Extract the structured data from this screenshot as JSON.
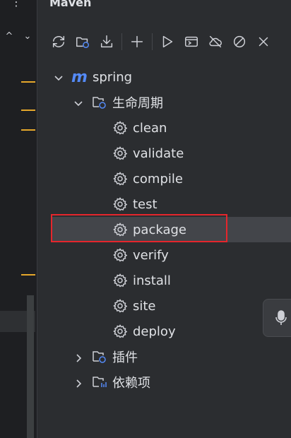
{
  "panel": {
    "title": "Maven"
  },
  "editor": {
    "menu_glyph": "⋮",
    "nav_up": "^",
    "nav_down": "⌄"
  },
  "toolbar": {
    "buttons": [
      {
        "name": "reload-icon"
      },
      {
        "name": "generate-sources-icon"
      },
      {
        "name": "download-icon"
      },
      {
        "name": "add-icon"
      },
      {
        "name": "run-icon"
      },
      {
        "name": "execute-goal-icon"
      },
      {
        "name": "offline-icon"
      },
      {
        "name": "skip-tests-icon"
      },
      {
        "name": "collapse-icon"
      }
    ]
  },
  "tree": {
    "project": "spring",
    "lifecycle_label": "生命周期",
    "goals": [
      "clean",
      "validate",
      "compile",
      "test",
      "package",
      "verify",
      "install",
      "site",
      "deploy"
    ],
    "selected_goal": "package",
    "plugins_label": "插件",
    "dependencies_label": "依赖项"
  },
  "colors": {
    "accent": "#548af7",
    "highlight_box": "#e5262c",
    "marker": "#e5a72b"
  }
}
